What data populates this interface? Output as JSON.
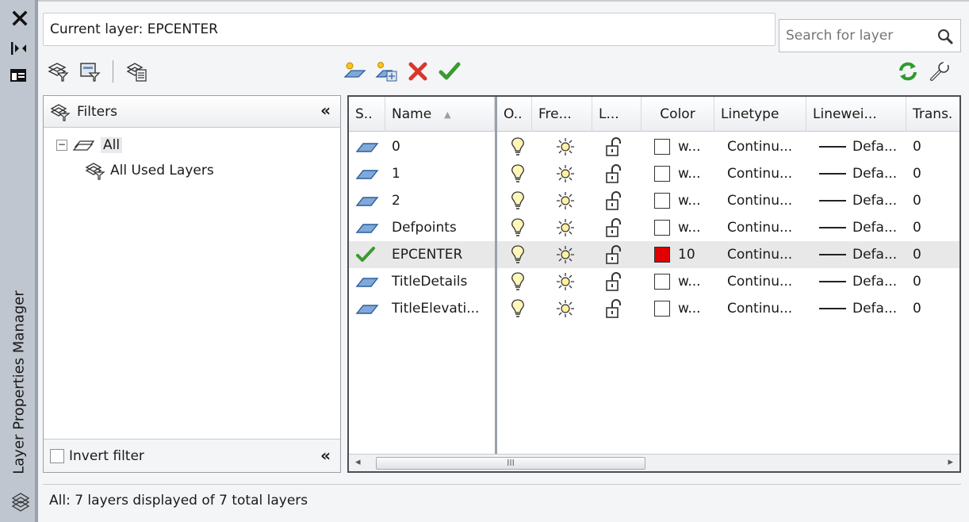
{
  "palette": {
    "vertical_title": "Layer Properties Manager"
  },
  "header": {
    "current_layer": "Current layer: EPCENTER",
    "search_placeholder": "Search for layer"
  },
  "filters": {
    "heading": "Filters",
    "tree": [
      {
        "label": "All"
      },
      {
        "label": "All Used Layers"
      }
    ],
    "invert_label": "Invert filter",
    "collapse_glyph": "«"
  },
  "grid": {
    "columns": [
      "S..",
      "Name",
      "O..",
      "Fre...",
      "L...",
      "Color",
      "Linetype",
      "Linewei...",
      "Trans."
    ],
    "rows": [
      {
        "status": "layer",
        "name": "0",
        "color_text": "w...",
        "color_hex": "#ffffff",
        "linetype": "Continu...",
        "lineweight": "Defa...",
        "trans": "0"
      },
      {
        "status": "layer",
        "name": "1",
        "color_text": "w...",
        "color_hex": "#ffffff",
        "linetype": "Continu...",
        "lineweight": "Defa...",
        "trans": "0"
      },
      {
        "status": "layer",
        "name": "2",
        "color_text": "w...",
        "color_hex": "#ffffff",
        "linetype": "Continu...",
        "lineweight": "Defa...",
        "trans": "0"
      },
      {
        "status": "layer",
        "name": "Defpoints",
        "color_text": "w...",
        "color_hex": "#ffffff",
        "linetype": "Continu...",
        "lineweight": "Defa...",
        "trans": "0"
      },
      {
        "status": "current",
        "name": "EPCENTER",
        "color_text": "10",
        "color_hex": "#e00000",
        "linetype": "Continu...",
        "lineweight": "Defa...",
        "trans": "0"
      },
      {
        "status": "layer",
        "name": "TitleDetails",
        "color_text": "w...",
        "color_hex": "#ffffff",
        "linetype": "Continu...",
        "lineweight": "Defa...",
        "trans": "0"
      },
      {
        "status": "layer",
        "name": "TitleElevati...",
        "color_text": "w...",
        "color_hex": "#ffffff",
        "linetype": "Continu...",
        "lineweight": "Defa...",
        "trans": "0"
      }
    ],
    "scroll_grip": "III"
  },
  "status_bar": {
    "text": "All: 7 layers displayed of 7 total layers"
  }
}
